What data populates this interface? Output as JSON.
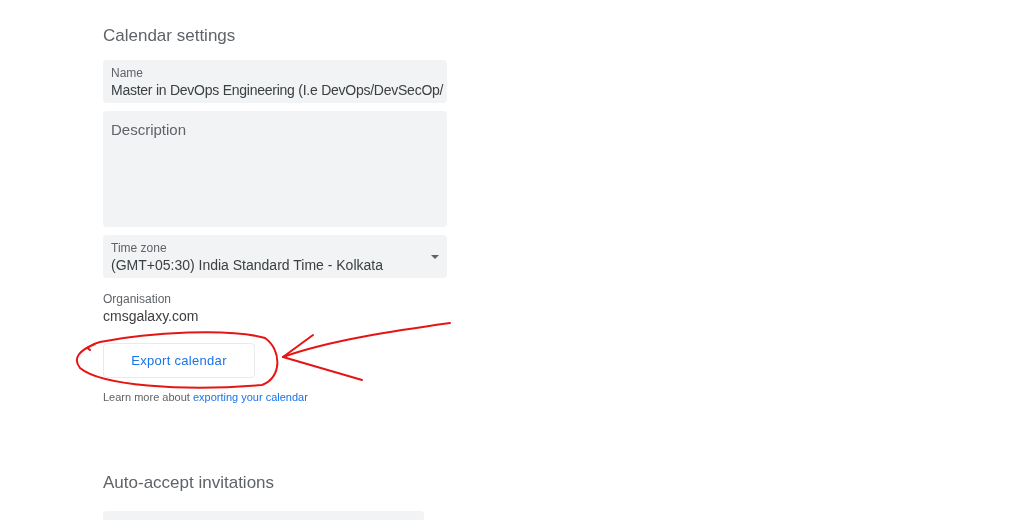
{
  "section_title": "Calendar settings",
  "name_field": {
    "label": "Name",
    "value": "Master in DevOps Engineering (I.e DevOps/DevSecOp/"
  },
  "description_field": {
    "placeholder": "Description"
  },
  "time_zone": {
    "label": "Time zone",
    "value": "(GMT+05:30) India Standard Time - Kolkata"
  },
  "organisation": {
    "label": "Organisation",
    "value": "cmsgalaxy.com"
  },
  "export_button": {
    "label": "Export calendar"
  },
  "learn_more": {
    "text": "Learn more about ",
    "link": "exporting your calendar"
  },
  "auto_accept": {
    "title": "Auto-accept invitations"
  }
}
